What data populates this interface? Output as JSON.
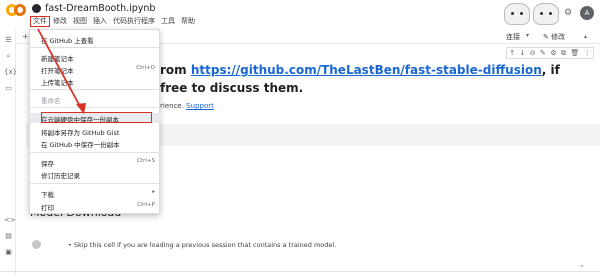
{
  "header": {
    "notebook_name": "fast-DreamBooth.ipynb",
    "menus": [
      "文件",
      "修改",
      "视图",
      "插入",
      "代码执行程序",
      "工具",
      "帮助"
    ],
    "share_icon": "gear-icon",
    "avatar_initial": "A"
  },
  "toolbar": {
    "add_label": "+",
    "connect_label": "连接",
    "edit_label": "✎ 修改"
  },
  "cell_tools": [
    "↑",
    "↓",
    "⊝",
    "✎",
    "⚙",
    "⧉",
    "🗑",
    "⋮"
  ],
  "content": {
    "heading_prefix": "rom ",
    "heading_link": "https://github.com/TheLastBen/fast-stable-diffusion",
    "heading_suffix": ", if",
    "heading_line2": "free to discuss them.",
    "note_prefix": "rience. ",
    "note_link": "Support",
    "section_title": "Model Download",
    "bullet": "Skip this cell if you are loading a previous session that contains a trained model."
  },
  "file_menu": {
    "items": [
      {
        "label": "在 GitHub 上查看",
        "shortcut": "",
        "dim": false
      },
      {
        "label": "新建笔记本",
        "shortcut": "",
        "dim": false
      },
      {
        "label": "打开笔记本",
        "shortcut": "Ctrl+O",
        "dim": false
      },
      {
        "label": "上传笔记本",
        "shortcut": "",
        "dim": false
      },
      {
        "label": "重命名",
        "shortcut": "",
        "dim": true
      },
      {
        "label": "在云端硬盘中保存一份副本",
        "shortcut": "",
        "dim": false
      },
      {
        "label": "将副本另存为 GitHub Gist",
        "shortcut": "",
        "dim": false
      },
      {
        "label": "在 GitHub 中保存一份副本",
        "shortcut": "",
        "dim": false
      },
      {
        "label": "保存",
        "shortcut": "Ctrl+S",
        "dim": false
      },
      {
        "label": "修订历史记录",
        "shortcut": "",
        "dim": false
      },
      {
        "label": "下载",
        "shortcut": "▸",
        "dim": false
      },
      {
        "label": "打印",
        "shortcut": "Ctrl+P",
        "dim": false
      }
    ]
  },
  "colors": {
    "accent": "#1967d2",
    "highlight_border": "#d93025",
    "logo_orange": "#f9ab00"
  }
}
